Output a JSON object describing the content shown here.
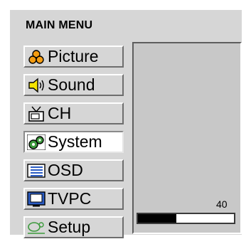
{
  "menu": {
    "title": "MAIN MENU",
    "items": [
      {
        "label": "Picture",
        "icon": "picture-icon"
      },
      {
        "label": "Sound",
        "icon": "sound-icon"
      },
      {
        "label": "CH",
        "icon": "tv-antenna-icon"
      },
      {
        "label": "System",
        "icon": "gears-icon"
      },
      {
        "label": "OSD",
        "icon": "osd-icon"
      },
      {
        "label": "TVPC",
        "icon": "monitor-icon"
      },
      {
        "label": "Setup",
        "icon": "setup-icon"
      }
    ],
    "selected": "System"
  },
  "adjust": {
    "value": "40",
    "level_fraction": 0.4
  },
  "colors": {
    "panel": "#d6d6d6",
    "display": "#c8c8c8",
    "fill": "#000000",
    "icon_orange": "#f39c12",
    "icon_yellow": "#f5e400",
    "icon_blue": "#2b5cc4",
    "icon_green": "#3c9a3c"
  }
}
